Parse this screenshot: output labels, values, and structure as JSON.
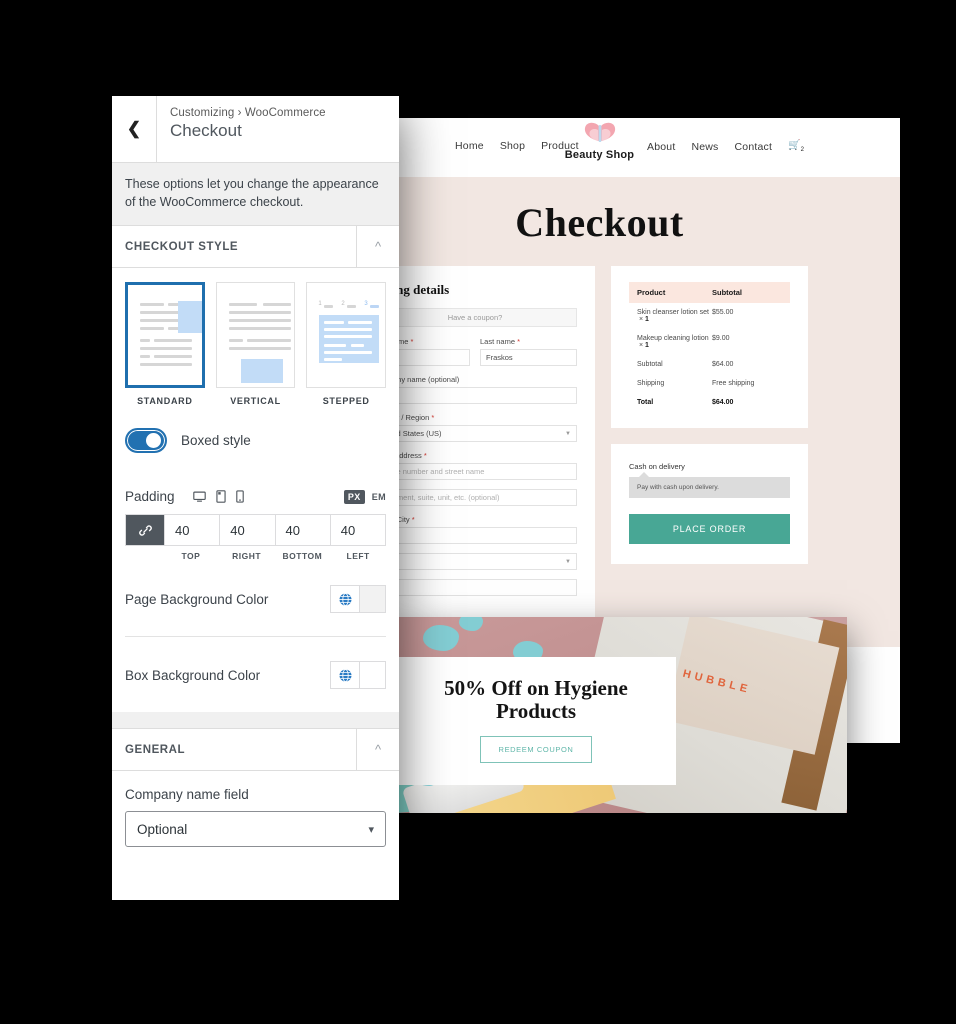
{
  "customizer": {
    "back_icon": "chevron-left-icon",
    "breadcrumb": "Customizing › WooCommerce",
    "title": "Checkout",
    "description": "These options let you change the appearance of the WooCommerce checkout.",
    "sections": {
      "checkout_style": "CHECKOUT STYLE",
      "general": "GENERAL"
    },
    "style_options": [
      {
        "label": "STANDARD",
        "selected": true
      },
      {
        "label": "VERTICAL",
        "selected": false
      },
      {
        "label": "STEPPED",
        "selected": false
      }
    ],
    "stepped_numbers": [
      "1",
      "2",
      "3"
    ],
    "boxed_style_label": "Boxed style",
    "boxed_style_on": true,
    "padding": {
      "label": "Padding",
      "devices": [
        "desktop-icon",
        "tablet-icon",
        "mobile-icon"
      ],
      "units": [
        "PX",
        "EM"
      ],
      "unit_selected": "PX",
      "link_icon": "link-icon",
      "values": [
        "40",
        "40",
        "40",
        "40"
      ],
      "side_labels": [
        "TOP",
        "RIGHT",
        "BOTTOM",
        "LEFT"
      ]
    },
    "colors": [
      {
        "label": "Page Background Color",
        "icon": "globe-icon",
        "swatch": "#f2f2f2"
      },
      {
        "label": "Box Background Color",
        "icon": "globe-icon",
        "swatch": "#ffffff"
      }
    ],
    "general": {
      "company_field_label": "Company name field",
      "company_field_value": "Optional",
      "caret_icon": "chevron-down-icon"
    },
    "accent_color": "#2271b1",
    "selected_border_color": "#1f6fae"
  },
  "preview": {
    "site": {
      "nav_left": [
        "Home",
        "Shop",
        "Product"
      ],
      "nav_right": [
        "About",
        "News",
        "Contact"
      ],
      "cart_icon": "cart-icon",
      "cart_count": "2",
      "brand_name": "Beauty Shop",
      "logo_icon": "butterfly-logo-icon",
      "page_title": "Checkout",
      "page_bg": "#f2e7e2"
    },
    "billing": {
      "heading": "Billing details",
      "coupon_text": "Have a coupon?",
      "first_name_label": "First name",
      "last_name_label": "Last name",
      "first_name_value": "",
      "last_name_value": "Fraskos",
      "company_label": "Company name (optional)",
      "company_value": "",
      "country_label": "Country / Region",
      "country_value": "United States (US)",
      "street_label": "Street address",
      "street_ph1": "House number and street name",
      "street_ph2": "Apartment, suite, unit, etc. (optional)",
      "city_label": "Town / City",
      "city_value": "",
      "state_value": "",
      "zip_value": ""
    },
    "order": {
      "headers": [
        "Product",
        "Subtotal"
      ],
      "rows": [
        {
          "name": "Skin cleanser lotion set",
          "qty": "1",
          "amount": "$55.00",
          "bold": false
        },
        {
          "name": "Makeup cleaning lotion",
          "qty": "1",
          "amount": "$9.00",
          "bold": false
        },
        {
          "name": "Subtotal",
          "qty": "",
          "amount": "$64.00",
          "bold": false
        },
        {
          "name": "Shipping",
          "qty": "",
          "amount": "Free shipping",
          "bold": false
        },
        {
          "name": "Total",
          "qty": "",
          "amount": "$64.00",
          "bold": true
        }
      ],
      "header_bg": "#fbe7df"
    },
    "payment": {
      "method": "Cash on delivery",
      "description": "Pay with cash upon delivery.",
      "button": "PLACE ORDER",
      "button_color": "#48a795"
    },
    "promo": {
      "headline": "50% Off on Hygiene Products",
      "button": "REDEEM COUPON",
      "box_brand": "HUBBLE",
      "button_color": "#5fb6a9"
    }
  }
}
